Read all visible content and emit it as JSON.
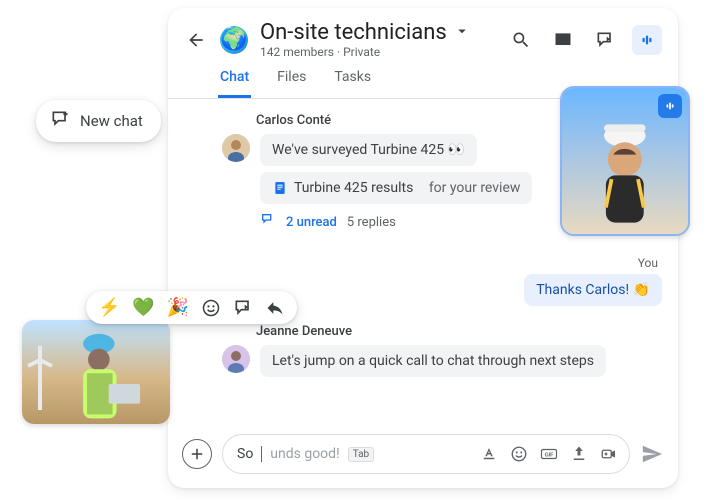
{
  "header": {
    "title": "On-site technicians",
    "members_text": "142 members",
    "privacy": "Private"
  },
  "tabs": [
    {
      "label": "Chat",
      "active": true
    },
    {
      "label": "Files",
      "active": false
    },
    {
      "label": "Tasks",
      "active": false
    }
  ],
  "thread": {
    "sender1_name": "Carlos Conté",
    "msg1_text": "We've surveyed Turbine 425 👀",
    "attachment_name": "Turbine 425 results",
    "attachment_suffix": "for your review",
    "unread_label": "2 unread",
    "replies_label": "5 replies",
    "you_label": "You",
    "you_msg": "Thanks Carlos! 👏",
    "sender2_name": "Jeanne Deneuve",
    "msg2_text": "Let's jump on a quick call to chat through next steps"
  },
  "composer": {
    "typed": "So",
    "ghost": "unds good!",
    "hint_key": "Tab"
  },
  "newchat": {
    "label": "New chat"
  },
  "reactions": {
    "bolt": "⚡",
    "heart": "💚",
    "party": "🎉"
  }
}
